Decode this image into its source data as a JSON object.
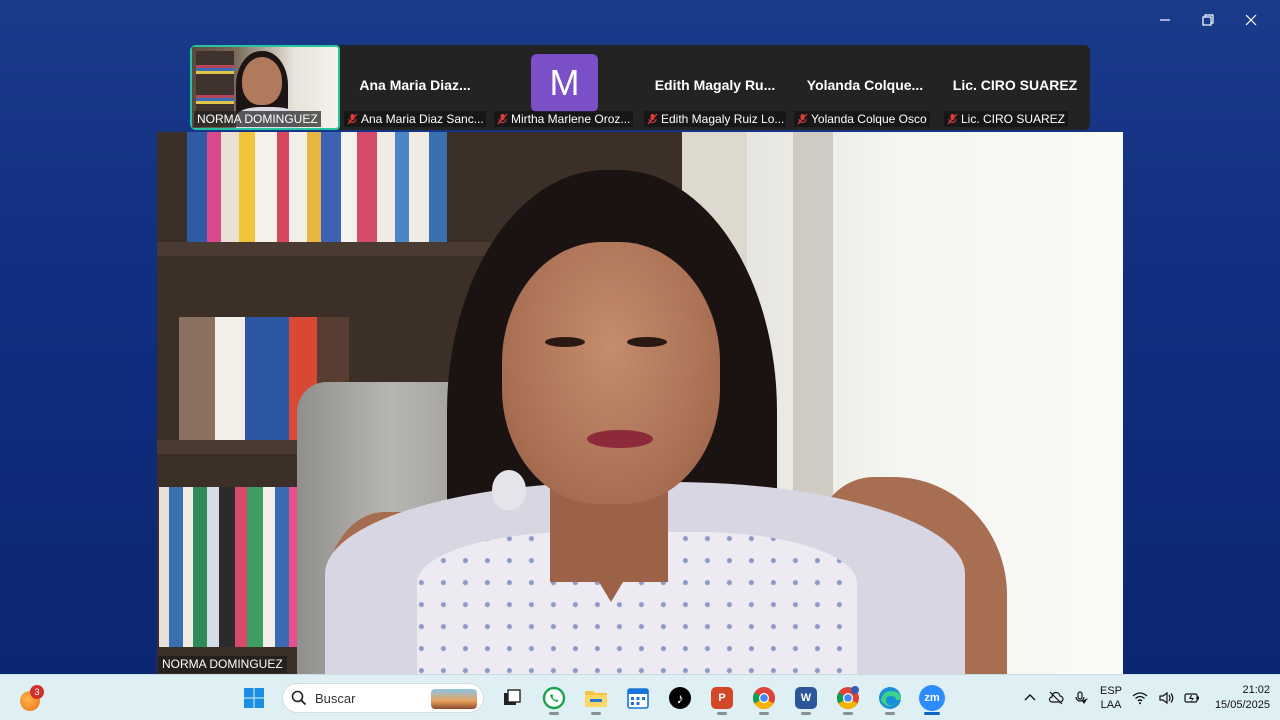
{
  "window": {
    "controls": [
      "minimize-icon",
      "restore-icon",
      "close-icon"
    ]
  },
  "filmstrip": {
    "tiles": [
      {
        "label": "NORMA DOMINGUEZ",
        "type": "video",
        "active": true,
        "muted": false
      },
      {
        "name": "Ana Maria Diaz...",
        "label": "Ana Maria Diaz Sanc...",
        "type": "name",
        "muted": true
      },
      {
        "avatar_letter": "M",
        "label": "Mirtha Marlene Oroz...",
        "type": "avatar",
        "muted": true,
        "avatar_color": "#7b4fc8"
      },
      {
        "name": "Edith Magaly Ru...",
        "label": "Edith Magaly Ruiz Lo...",
        "type": "name",
        "muted": true
      },
      {
        "name": "Yolanda Colque...",
        "label": "Yolanda Colque Osco",
        "type": "name",
        "muted": true
      },
      {
        "name": "Lic. CIRO SUAREZ",
        "label": "Lic. CIRO SUAREZ",
        "type": "name",
        "muted": true
      }
    ],
    "active_border_color": "#27c4a3"
  },
  "main_video": {
    "label": "NORMA DOMINGUEZ"
  },
  "taskbar": {
    "widget_badge": "3",
    "search_placeholder": "Buscar",
    "apps": [
      "start-icon",
      "task-view-icon",
      "whatsapp-icon",
      "file-explorer-icon",
      "calendar-icon",
      "tiktok-icon",
      "powerpoint-icon",
      "chrome-icon",
      "word-icon",
      "chrome-profile-icon",
      "edge-icon",
      "zoom-icon"
    ],
    "zoom_glyph": "zm",
    "tray": {
      "lang_top": "ESP",
      "lang_bottom": "LAA",
      "time": "21:02",
      "date": "15/05/2025"
    }
  },
  "colors": {
    "background": "#1a3a8a",
    "taskbar": "#dff0f4",
    "muted_red": "#e03b3b"
  }
}
